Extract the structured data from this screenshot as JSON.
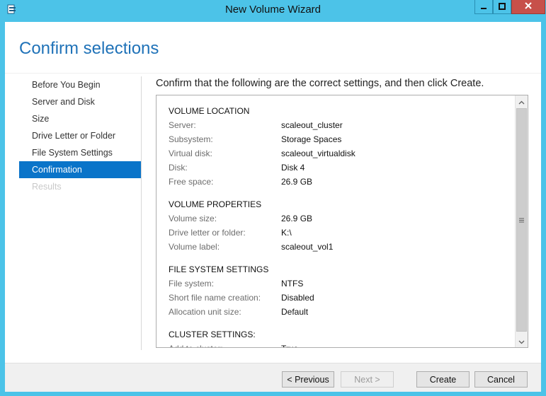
{
  "window": {
    "title": "New Volume Wizard",
    "icons": [
      "wizard-app-icon",
      "minimize-icon",
      "maximize-icon",
      "close-icon"
    ]
  },
  "page": {
    "title": "Confirm selections",
    "instruction": "Confirm that the following are the correct settings, and then click Create."
  },
  "nav": {
    "items": [
      {
        "label": "Before You Begin",
        "state": "normal"
      },
      {
        "label": "Server and Disk",
        "state": "normal"
      },
      {
        "label": "Size",
        "state": "normal"
      },
      {
        "label": "Drive Letter or Folder",
        "state": "normal"
      },
      {
        "label": "File System Settings",
        "state": "normal"
      },
      {
        "label": "Confirmation",
        "state": "active"
      },
      {
        "label": "Results",
        "state": "disabled"
      }
    ]
  },
  "summary": {
    "sections": [
      {
        "heading": "VOLUME LOCATION",
        "rows": [
          {
            "key": "Server:",
            "value": "scaleout_cluster"
          },
          {
            "key": "Subsystem:",
            "value": "Storage Spaces"
          },
          {
            "key": "Virtual disk:",
            "value": "scaleout_virtualdisk"
          },
          {
            "key": "Disk:",
            "value": "Disk 4"
          },
          {
            "key": "Free space:",
            "value": "26.9 GB"
          }
        ]
      },
      {
        "heading": "VOLUME PROPERTIES",
        "rows": [
          {
            "key": "Volume size:",
            "value": "26.9 GB"
          },
          {
            "key": "Drive letter or folder:",
            "value": "K:\\"
          },
          {
            "key": "Volume label:",
            "value": "scaleout_vol1"
          }
        ]
      },
      {
        "heading": "FILE SYSTEM SETTINGS",
        "rows": [
          {
            "key": "File system:",
            "value": "NTFS"
          },
          {
            "key": "Short file name creation:",
            "value": "Disabled"
          },
          {
            "key": "Allocation unit size:",
            "value": "Default"
          }
        ]
      },
      {
        "heading": "CLUSTER SETTINGS:",
        "rows": [
          {
            "key": "Add to cluster:",
            "value": "True"
          }
        ]
      }
    ]
  },
  "footer": {
    "previous_label": "< Previous",
    "next_label": "Next >",
    "create_label": "Create",
    "cancel_label": "Cancel"
  },
  "colors": {
    "frame": "#4cc3e8",
    "accent": "#0a74c9",
    "title": "#1f72b8",
    "close": "#c7504a"
  }
}
